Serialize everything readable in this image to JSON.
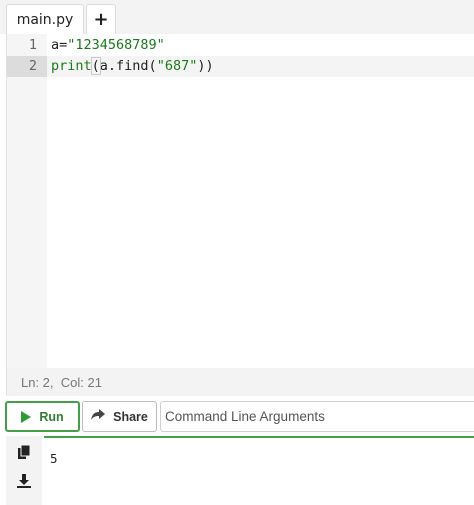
{
  "tabs": {
    "file_label": "main.py",
    "add_label": "+"
  },
  "editor": {
    "lines": [
      {
        "number": "1",
        "segments": {
          "a": "a=",
          "b": "\"1234568789\""
        }
      },
      {
        "number": "2",
        "segments": {
          "a": "print",
          "b": "(",
          "c": "a.find(",
          "d": "\"687\"",
          "e": "))"
        }
      }
    ]
  },
  "status": {
    "text": "Ln: 2,  Col: 21"
  },
  "toolbar": {
    "run_label": "Run",
    "share_label": "Share",
    "args_placeholder": "Command Line Arguments"
  },
  "output": {
    "text": "5"
  },
  "colors": {
    "accent": "#43a047",
    "string": "#1a7a1a"
  }
}
